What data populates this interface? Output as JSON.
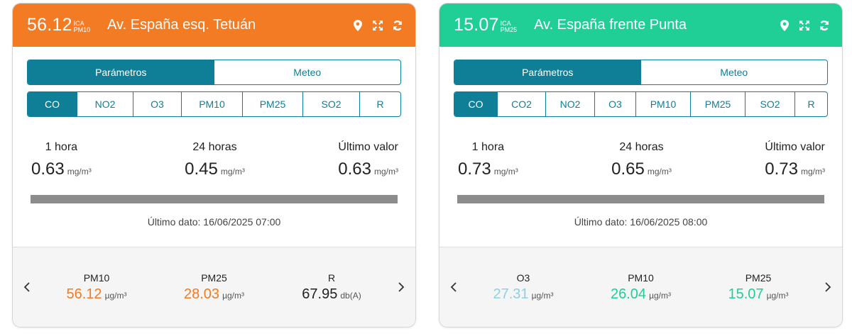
{
  "colors": {
    "orange": "#f27b23",
    "green": "#1fcf96",
    "teal": "#0e7f97",
    "lightblue": "#8fd0e3"
  },
  "cards": [
    {
      "header": {
        "ica_value": "56.12",
        "ica_label": "ICA",
        "ica_pollutant": "PM10",
        "station": "Av. España esq. Tetuán",
        "color": "#f27b23"
      },
      "tabs": [
        "Parámetros",
        "Meteo"
      ],
      "params": [
        "CO",
        "NO2",
        "O3",
        "PM10",
        "PM25",
        "SO2",
        "R"
      ],
      "stats": [
        {
          "label": "1 hora",
          "value": "0.63",
          "unit": "mg/m³"
        },
        {
          "label": "24 horas",
          "value": "0.45",
          "unit": "mg/m³"
        },
        {
          "label": "Último valor",
          "value": "0.63",
          "unit": "mg/m³"
        }
      ],
      "last_data": "Último dato: 16/06/2025 07:00",
      "footer": [
        {
          "label": "PM10",
          "value": "56.12",
          "unit": "µg/m³",
          "color": "#f27b23"
        },
        {
          "label": "PM25",
          "value": "28.03",
          "unit": "µg/m³",
          "color": "#f27b23"
        },
        {
          "label": "R",
          "value": "67.95",
          "unit": "db(A)",
          "color": "#222222"
        }
      ]
    },
    {
      "header": {
        "ica_value": "15.07",
        "ica_label": "ICA",
        "ica_pollutant": "PM25",
        "station": "Av. España frente Punta",
        "color": "#1fcf96"
      },
      "tabs": [
        "Parámetros",
        "Meteo"
      ],
      "params": [
        "CO",
        "CO2",
        "NO2",
        "O3",
        "PM10",
        "PM25",
        "SO2",
        "R"
      ],
      "stats": [
        {
          "label": "1 hora",
          "value": "0.73",
          "unit": "mg/m³"
        },
        {
          "label": "24 horas",
          "value": "0.65",
          "unit": "mg/m³"
        },
        {
          "label": "Último valor",
          "value": "0.73",
          "unit": "mg/m³"
        }
      ],
      "last_data": "Último dato: 16/06/2025 08:00",
      "footer": [
        {
          "label": "O3",
          "value": "27.31",
          "unit": "µg/m³",
          "color": "#8fd0e3"
        },
        {
          "label": "PM10",
          "value": "26.04",
          "unit": "µg/m³",
          "color": "#1fcf96"
        },
        {
          "label": "PM25",
          "value": "15.07",
          "unit": "µg/m³",
          "color": "#1fcf96"
        }
      ]
    }
  ]
}
